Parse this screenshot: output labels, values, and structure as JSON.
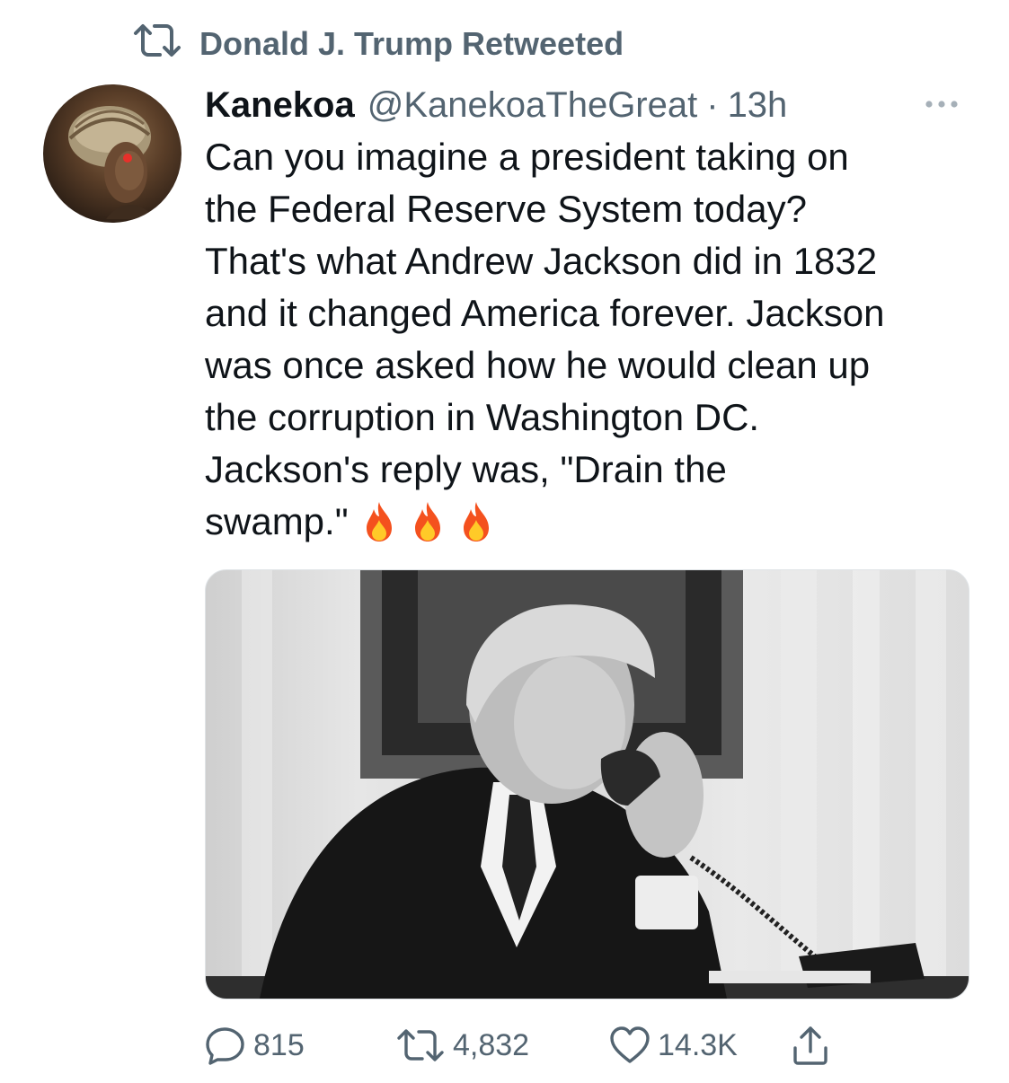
{
  "retweet_context": {
    "text": "Donald J. Trump Retweeted",
    "icon": "retweet-icon"
  },
  "tweet": {
    "author_name": "Kanekoa",
    "handle": "@KanekoaTheGreat",
    "separator": "·",
    "time": "13h",
    "more_icon": "more-icon",
    "text_lines": [
      "Can you imagine a president taking on",
      "the Federal Reserve System today?",
      "That's what Andrew Jackson did in 1832",
      "and it changed America forever. Jackson",
      "was once asked how he would clean up",
      "the corruption in Washington DC.",
      "Jackson's reply was, \"Drain the",
      "swamp.\""
    ],
    "emoji": [
      "fire-emoji",
      "fire-emoji",
      "fire-emoji"
    ]
  },
  "actions": {
    "reply_count": "815",
    "retweet_count": "4,832",
    "like_count": "14.3K",
    "share_icon": "share-icon"
  },
  "colors": {
    "text": "#0f1419",
    "secondary": "#536471",
    "background": "#ffffff"
  }
}
